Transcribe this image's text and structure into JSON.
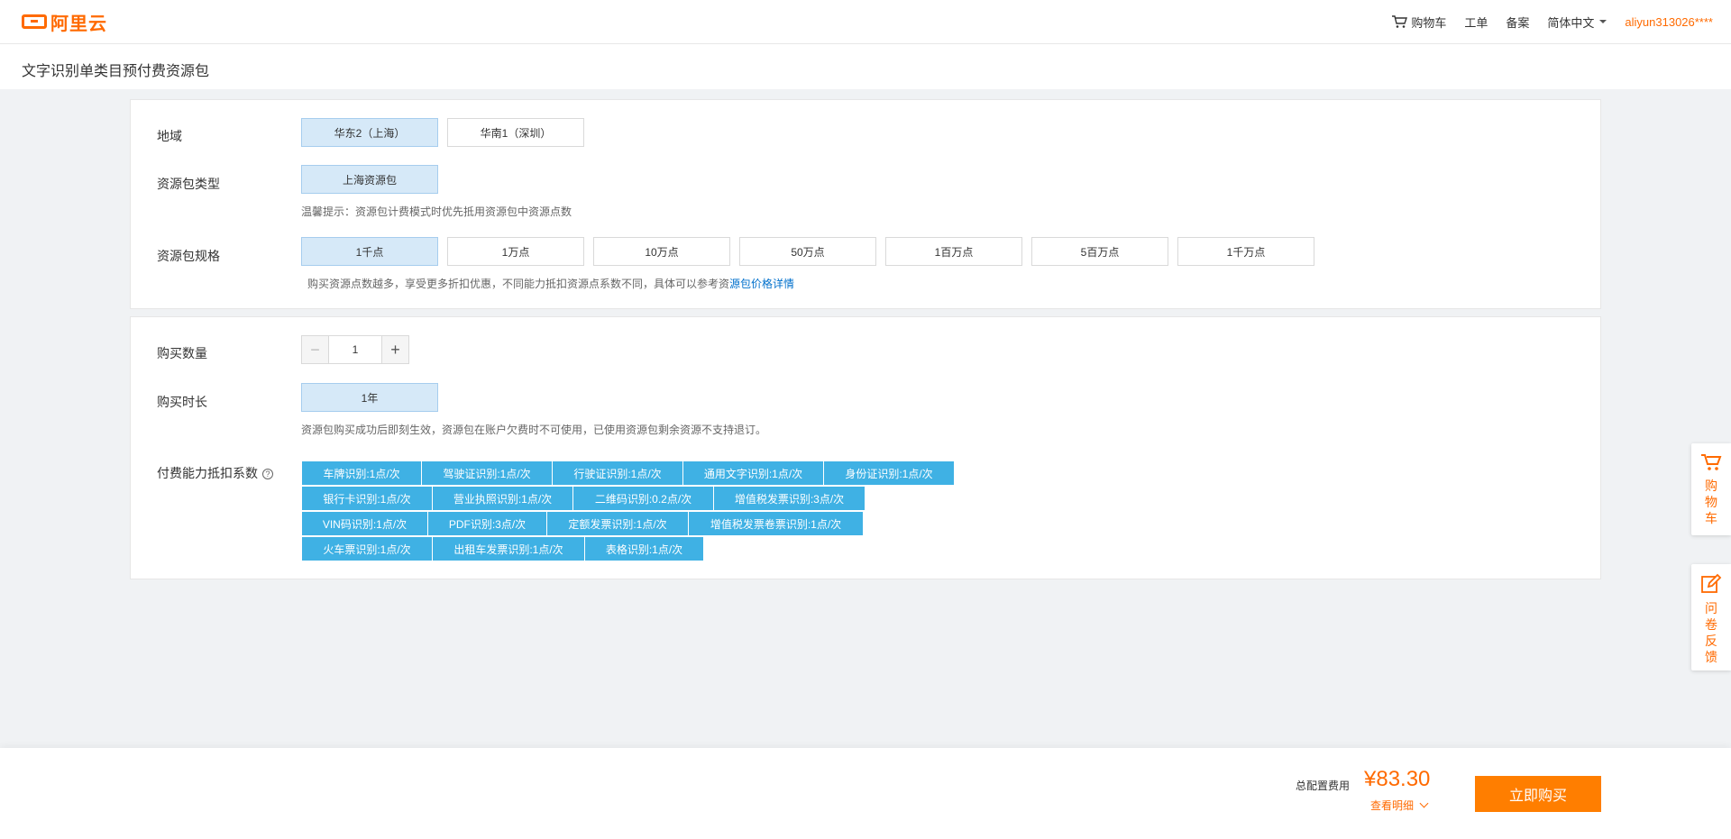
{
  "header": {
    "logo_text": "阿里云",
    "cart_label": "购物车",
    "ticket_label": "工单",
    "filing_label": "备案",
    "language_label": "简体中文",
    "user_label": "aliyun313026****"
  },
  "page": {
    "title": "文字识别单类目预付费资源包"
  },
  "config": {
    "region_label": "地域",
    "regions": [
      "华东2（上海）",
      "华南1（深圳）"
    ],
    "type_label": "资源包类型",
    "types": [
      "上海资源包"
    ],
    "type_hint": "温馨提示：资源包计费模式时优先抵用资源包中资源点数",
    "spec_label": "资源包规格",
    "specs": [
      "1千点",
      "1万点",
      "10万点",
      "50万点",
      "1百万点",
      "5百万点",
      "1千万点"
    ],
    "spec_hint": "购买资源点数越多，享受更多折扣优惠，不同能力抵扣资源点系数不同，具体可以参考资",
    "spec_hint_link": "源包价格详情"
  },
  "purchase": {
    "quantity_label": "购买数量",
    "quantity_value": "1",
    "duration_label": "购买时长",
    "durations": [
      "1年"
    ],
    "duration_hint": "资源包购买成功后即刻生效，资源包在账户欠费时不可使用，已使用资源包剩余资源不支持退订。",
    "coef_label": "付费能力抵扣系数",
    "coef_rows": [
      [
        "车牌识别:1点/次",
        "驾驶证识别:1点/次",
        "行驶证识别:1点/次",
        "通用文字识别:1点/次",
        "身份证识别:1点/次"
      ],
      [
        "银行卡识别:1点/次",
        "营业执照识别:1点/次",
        "二维码识别:0.2点/次",
        "增值税发票识别:3点/次"
      ],
      [
        "VIN码识别:1点/次",
        "PDF识别:3点/次",
        "定额发票识别:1点/次",
        "增值税发票卷票识别:1点/次"
      ],
      [
        "火车票识别:1点/次",
        "出租车发票识别:1点/次",
        "表格识别:1点/次"
      ]
    ]
  },
  "side": {
    "cart_text": [
      "购",
      "物",
      "车"
    ],
    "survey_text": [
      "问",
      "卷",
      "反",
      "馈"
    ]
  },
  "footer": {
    "fee_label": "总配置费用",
    "fee_amount": "¥83.30",
    "detail_label": "查看明细",
    "buy_label": "立即购买"
  },
  "colors": {
    "accent": "#ff6a00",
    "selected_bg": "#d6e9f8",
    "tag_bg": "#3fb1e4"
  }
}
